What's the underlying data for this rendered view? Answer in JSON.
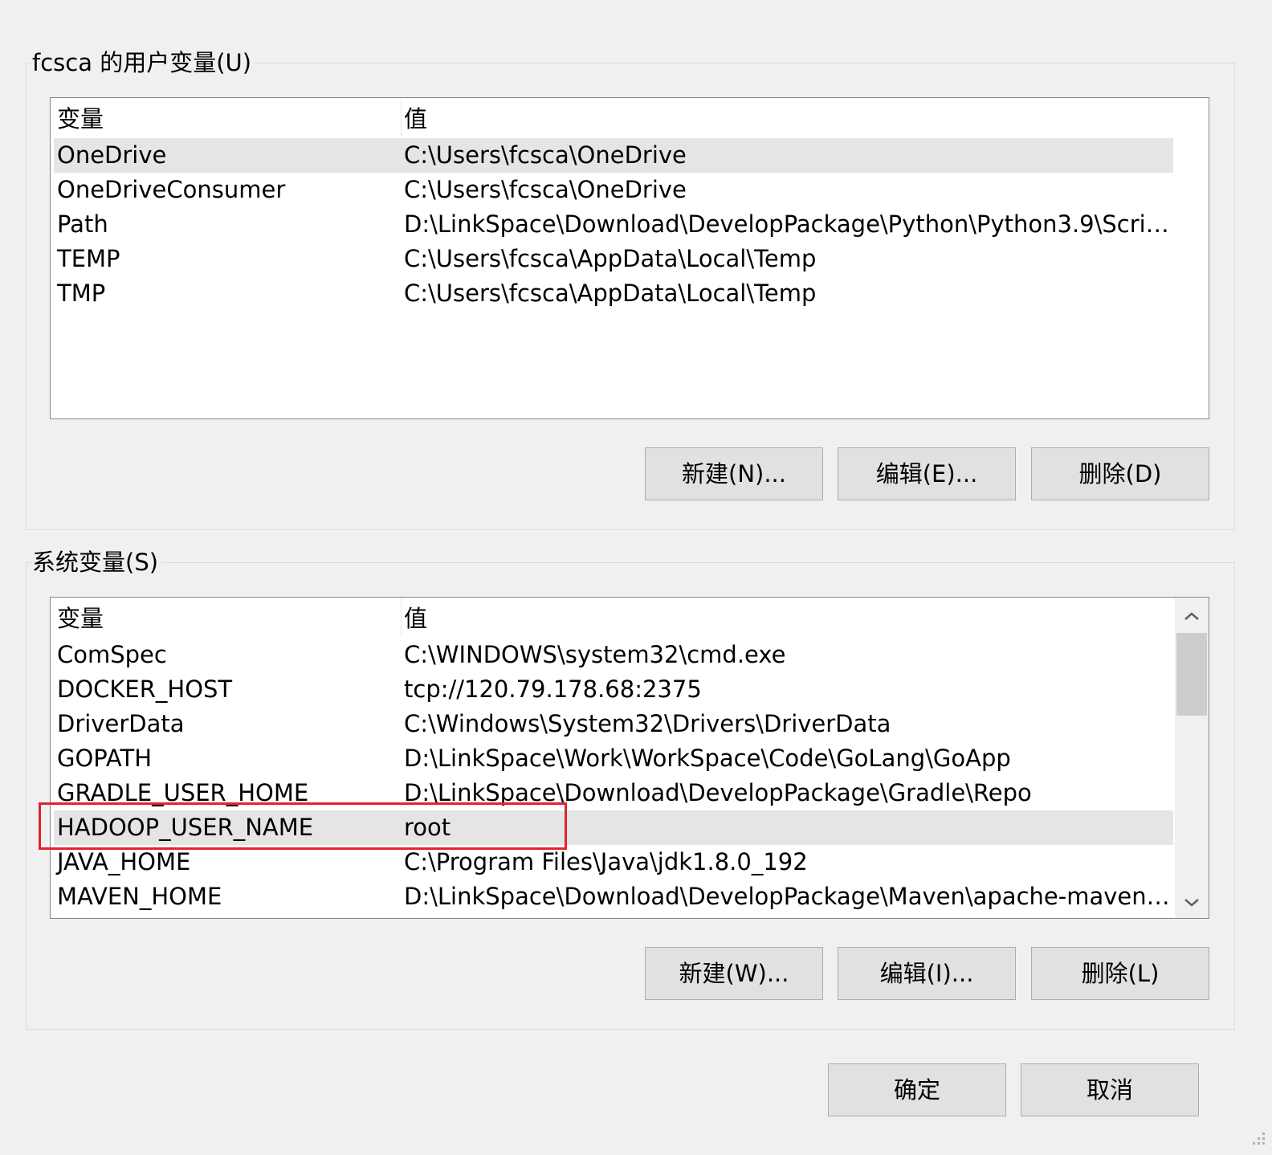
{
  "user_vars": {
    "title": "fcsca 的用户变量(U)",
    "col_name": "变量",
    "col_value": "值",
    "rows": [
      {
        "name": "OneDrive",
        "value": "C:\\Users\\fcsca\\OneDrive"
      },
      {
        "name": "OneDriveConsumer",
        "value": "C:\\Users\\fcsca\\OneDrive"
      },
      {
        "name": "Path",
        "value": "D:\\LinkSpace\\Download\\DevelopPackage\\Python\\Python3.9\\Scrip..."
      },
      {
        "name": "TEMP",
        "value": "C:\\Users\\fcsca\\AppData\\Local\\Temp"
      },
      {
        "name": "TMP",
        "value": "C:\\Users\\fcsca\\AppData\\Local\\Temp"
      }
    ],
    "new_label": "新建(N)...",
    "edit_label": "编辑(E)...",
    "delete_label": "删除(D)"
  },
  "system_vars": {
    "title": "系统变量(S)",
    "col_name": "变量",
    "col_value": "值",
    "rows": [
      {
        "name": "ComSpec",
        "value": "C:\\WINDOWS\\system32\\cmd.exe"
      },
      {
        "name": "DOCKER_HOST",
        "value": "tcp://120.79.178.68:2375"
      },
      {
        "name": "DriverData",
        "value": "C:\\Windows\\System32\\Drivers\\DriverData"
      },
      {
        "name": "GOPATH",
        "value": "D:\\LinkSpace\\Work\\WorkSpace\\Code\\GoLang\\GoApp"
      },
      {
        "name": "GRADLE_USER_HOME",
        "value": "D:\\LinkSpace\\Download\\DevelopPackage\\Gradle\\Repo"
      },
      {
        "name": "HADOOP_USER_NAME",
        "value": "root"
      },
      {
        "name": "JAVA_HOME",
        "value": "C:\\Program Files\\Java\\jdk1.8.0_192"
      },
      {
        "name": "MAVEN_HOME",
        "value": "D:\\LinkSpace\\Download\\DevelopPackage\\Maven\\apache-maven-..."
      }
    ],
    "new_label": "新建(W)...",
    "edit_label": "编辑(I)...",
    "delete_label": "删除(L)"
  },
  "dialog": {
    "ok_label": "确定",
    "cancel_label": "取消"
  },
  "icons": {
    "scroll_up": "chevron-up-icon",
    "scroll_down": "chevron-down-icon",
    "resize_grip": "resize-grip-icon"
  },
  "colors": {
    "highlight_box": "#e0242f",
    "selected_row": "#e5e5e5"
  }
}
